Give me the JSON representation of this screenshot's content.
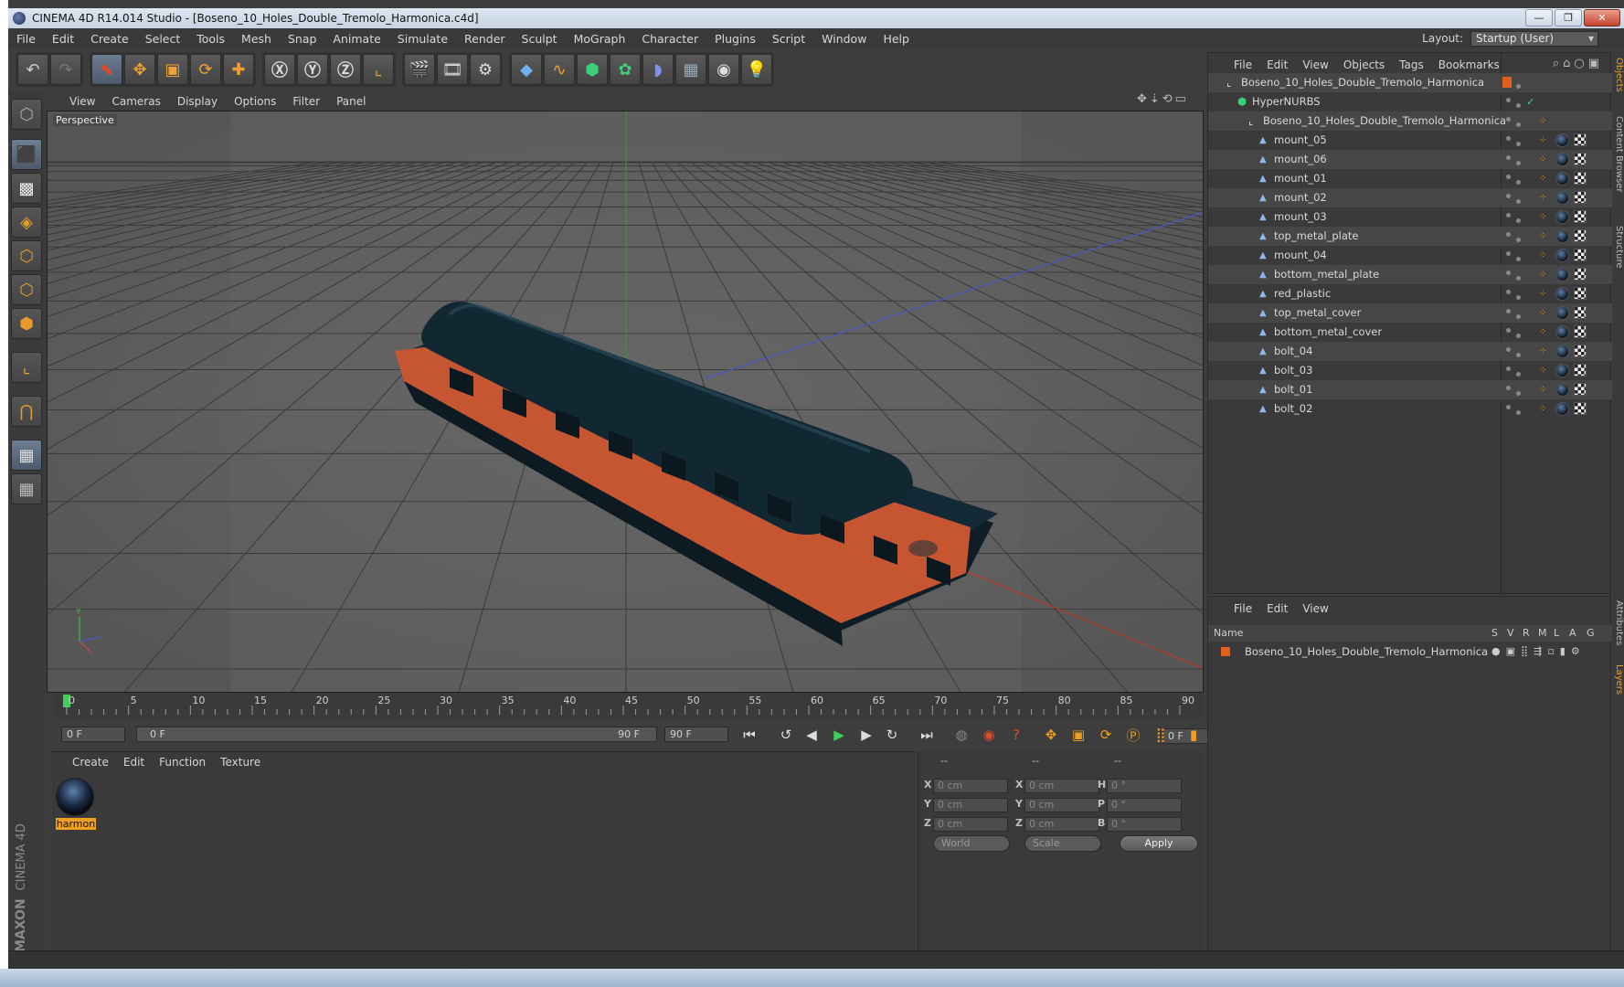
{
  "window": {
    "title": "CINEMA 4D R14.014 Studio - [Boseno_10_Holes_Double_Tremolo_Harmonica.c4d]",
    "minimize": "—",
    "restore": "❐",
    "close": "✕"
  },
  "menubar": [
    "File",
    "Edit",
    "Create",
    "Select",
    "Tools",
    "Mesh",
    "Snap",
    "Animate",
    "Simulate",
    "Render",
    "Sculpt",
    "MoGraph",
    "Character",
    "Plugins",
    "Script",
    "Window",
    "Help"
  ],
  "layout": {
    "label": "Layout:",
    "value": "Startup (User)"
  },
  "viewport": {
    "menu": [
      "View",
      "Cameras",
      "Display",
      "Options",
      "Filter",
      "Panel"
    ],
    "label": "Perspective"
  },
  "timeline": {
    "ticks": [
      "0",
      "5",
      "10",
      "15",
      "20",
      "25",
      "30",
      "35",
      "40",
      "45",
      "50",
      "55",
      "60",
      "65",
      "70",
      "75",
      "80",
      "85",
      "90"
    ],
    "current_frame": "0 F",
    "start": "0 F",
    "range_start": "0 F",
    "range_end": "90 F",
    "end": "90 F"
  },
  "material_panel": {
    "menu": [
      "Create",
      "Edit",
      "Function",
      "Texture"
    ],
    "materials": [
      {
        "name": "harmon"
      }
    ]
  },
  "coordinates": {
    "headers": [
      "--",
      "--",
      "--"
    ],
    "rows": [
      {
        "a": "X",
        "av": "0 cm",
        "b": "X",
        "bv": "0 cm",
        "c": "H",
        "cv": "0 °"
      },
      {
        "a": "Y",
        "av": "0 cm",
        "b": "Y",
        "bv": "0 cm",
        "c": "P",
        "cv": "0 °"
      },
      {
        "a": "Z",
        "av": "0 cm",
        "b": "Z",
        "bv": "0 cm",
        "c": "B",
        "cv": "0 °"
      }
    ],
    "space": "World",
    "mode": "Scale",
    "apply": "Apply"
  },
  "objects_panel": {
    "menu": [
      "File",
      "Edit",
      "View",
      "Objects",
      "Tags",
      "Bookmarks"
    ],
    "items": [
      {
        "name": "Boseno_10_Holes_Double_Tremolo_Harmonica",
        "type": "null",
        "depth": 0
      },
      {
        "name": "HyperNURBS",
        "type": "nurbs",
        "depth": 1
      },
      {
        "name": "Boseno_10_Holes_Double_Tremolo_Harmonica",
        "type": "null",
        "depth": 2
      },
      {
        "name": "mount_05",
        "type": "poly",
        "depth": 3
      },
      {
        "name": "mount_06",
        "type": "poly",
        "depth": 3
      },
      {
        "name": "mount_01",
        "type": "poly",
        "depth": 3
      },
      {
        "name": "mount_02",
        "type": "poly",
        "depth": 3
      },
      {
        "name": "mount_03",
        "type": "poly",
        "depth": 3
      },
      {
        "name": "top_metal_plate",
        "type": "poly",
        "depth": 3
      },
      {
        "name": "mount_04",
        "type": "poly",
        "depth": 3
      },
      {
        "name": "bottom_metal_plate",
        "type": "poly",
        "depth": 3
      },
      {
        "name": "red_plastic",
        "type": "poly",
        "depth": 3
      },
      {
        "name": "top_metal_cover",
        "type": "poly",
        "depth": 3
      },
      {
        "name": "bottom_metal_cover",
        "type": "poly",
        "depth": 3
      },
      {
        "name": "bolt_04",
        "type": "poly",
        "depth": 3
      },
      {
        "name": "bolt_03",
        "type": "poly",
        "depth": 3
      },
      {
        "name": "bolt_01",
        "type": "poly",
        "depth": 3
      },
      {
        "name": "bolt_02",
        "type": "poly",
        "depth": 3
      }
    ]
  },
  "layers_panel": {
    "menu": [
      "File",
      "Edit",
      "View"
    ],
    "columns": {
      "name": "Name",
      "flags": [
        "S",
        "V",
        "R",
        "M",
        "L",
        "A",
        "G"
      ]
    },
    "items": [
      {
        "name": "Boseno_10_Holes_Double_Tremolo_Harmonica",
        "color": "#e0601c"
      }
    ]
  },
  "side_tabs": [
    "Objects",
    "Content Browser",
    "Structure",
    "Attributes",
    "Layers"
  ],
  "brand": {
    "line1": "MAXON",
    "line2": "CINEMA 4D"
  },
  "colors": {
    "accent": "#f0a020",
    "selection": "#e0601c",
    "harmonica_red": "#c85a35"
  }
}
